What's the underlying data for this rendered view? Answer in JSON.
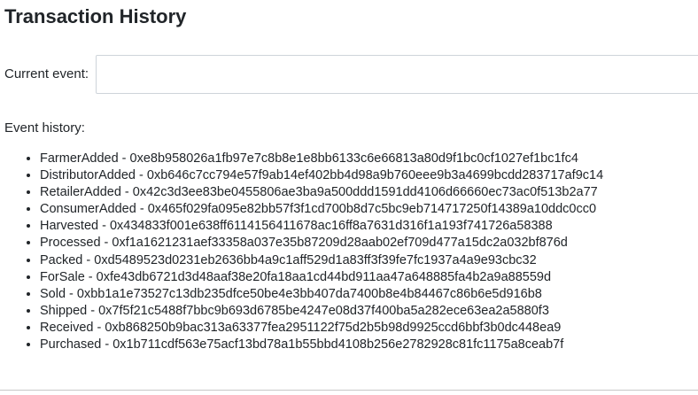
{
  "page": {
    "title": "Transaction History"
  },
  "current_event": {
    "label": "Current event:",
    "value": "",
    "placeholder": ""
  },
  "history": {
    "label": "Event history:",
    "items": [
      "FarmerAdded - 0xe8b958026a1fb97e7c8b8e1e8bb6133c6e66813a80d9f1bc0cf1027ef1bc1fc4",
      "DistributorAdded - 0xb646c7cc794e57f9ab14ef402bb4d98a9b760eee9b3a4699bcdd283717af9c14",
      "RetailerAdded - 0x42c3d3ee83be0455806ae3ba9a500ddd1591dd4106d66660ec73ac0f513b2a77",
      "ConsumerAdded - 0x465f029fa095e82bb57f3f1cd700b8d7c5bc9eb714717250f14389a10ddc0cc0",
      "Harvested - 0x434833f001e638ff6114156411678ac16ff8a7631d316f1a193f741726a58388",
      "Processed - 0xf1a1621231aef33358a037e35b87209d28aab02ef709d477a15dc2a032bf876d",
      "Packed - 0xd5489523d0231eb2636bb4a9c1aff529d1a83ff3f39fe7fc1937a4a9e93cbc32",
      "ForSale - 0xfe43db6721d3d48aaf38e20fa18aa1cd44bd911aa47a648885fa4b2a9a88559d",
      "Sold - 0xbb1a1e73527c13db235dfce50be4e3bb407da7400b8e4b84467c86b6e5d916b8",
      "Shipped - 0x7f5f21c5488f7bbc9b693d6785be4247e08d37f400ba5a282ece63ea2a5880f3",
      "Received - 0xb868250b9bac313a63377fea2951122f75d2b5b98d9925ccd6bbf3b0dc448ea9",
      "Purchased - 0x1b711cdf563e75acf13bd78a1b55bbd4108b256e2782928c81fc1175a8ceab7f"
    ]
  }
}
